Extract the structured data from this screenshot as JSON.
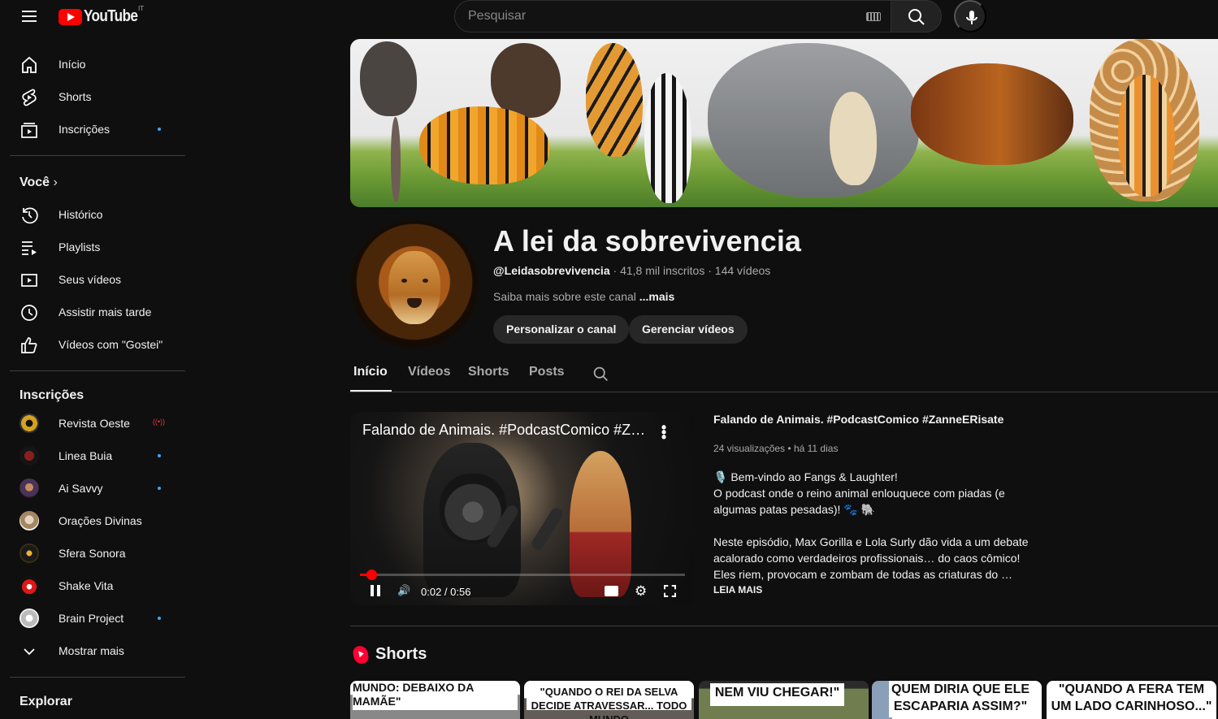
{
  "header": {
    "logo_text": "YouTube",
    "country_code": "IT",
    "search_placeholder": "Pesquisar"
  },
  "sidebar": {
    "main_items": [
      {
        "label": "Início",
        "icon": "home-icon"
      },
      {
        "label": "Shorts",
        "icon": "shorts-icon"
      },
      {
        "label": "Inscrições",
        "icon": "subscriptions-icon",
        "has_dot": true
      }
    ],
    "you_section": {
      "title": "Você",
      "items": [
        {
          "label": "Histórico",
          "icon": "history-icon"
        },
        {
          "label": "Playlists",
          "icon": "playlists-icon"
        },
        {
          "label": "Seus vídeos",
          "icon": "your-videos-icon"
        },
        {
          "label": "Assistir mais tarde",
          "icon": "watch-later-icon"
        },
        {
          "label": "Vídeos com \"Gostei\"",
          "icon": "liked-videos-icon"
        }
      ]
    },
    "subscriptions": {
      "title": "Inscrições",
      "items": [
        {
          "label": "Revista Oeste",
          "status": "live"
        },
        {
          "label": "Linea Buia",
          "status": "new"
        },
        {
          "label": "Ai Savvy",
          "status": "new"
        },
        {
          "label": "Orações Divinas",
          "status": ""
        },
        {
          "label": "Sfera Sonora",
          "status": ""
        },
        {
          "label": "Shake Vita",
          "status": ""
        },
        {
          "label": "Brain Project",
          "status": "new"
        }
      ],
      "show_more": "Mostrar mais"
    },
    "explore_title": "Explorar"
  },
  "channel": {
    "name": "A lei da sobrevivencia",
    "handle": "@Leidasobrevivencia",
    "subscribers": "41,8 mil inscritos",
    "video_count": "144 vídeos",
    "about": "Saiba mais sobre este canal",
    "more_label": "...mais",
    "buttons": {
      "customize": "Personalizar o canal",
      "manage": "Gerenciar vídeos"
    },
    "tabs": [
      "Início",
      "Vídeos",
      "Shorts",
      "Posts"
    ]
  },
  "featured_video": {
    "player_title": "Falando de Animais. #PodcastComico #Z…",
    "title": "Falando de Animais. #PodcastComico #ZanneERisate",
    "views": "24 visualizações",
    "age": "há 11 dias",
    "time": "0:02 / 0:56",
    "progress": 0.036,
    "description": [
      "🎙️ Bem-vindo ao Fangs & Laughter!",
      "O podcast onde o reino animal enlouquece com piadas (e algumas patas pesadas)! 🐾 🐘",
      "Neste episódio, Max Gorilla e Lola Surly dão vida a um debate acalorado como verdadeiros profissionais… do caos cômico! Eles riem, provocam e zombam de todas as criaturas do …"
    ],
    "read_more": "LEIA MAIS"
  },
  "shorts": {
    "title": "Shorts",
    "items": [
      {
        "caption": "MUNDO: DEBAIXO DA MAMÃE\""
      },
      {
        "caption": "\"QUANDO O REI DA SELVA DECIDE ATRAVESSAR... TODO MUNDO"
      },
      {
        "caption": "NEM VIU CHEGAR!\""
      },
      {
        "caption": "QUEM DIRIA QUE ELE ESCAPARIA ASSIM?\""
      },
      {
        "caption": "\"QUANDO A FERA TEM UM LADO CARINHOSO...\""
      }
    ]
  },
  "colors": {
    "background": "#0f0f0f",
    "text": "#f1f1f1",
    "secondary_text": "#aaaaaa",
    "accent": "#ff0000",
    "link": "#3ea6ff"
  }
}
